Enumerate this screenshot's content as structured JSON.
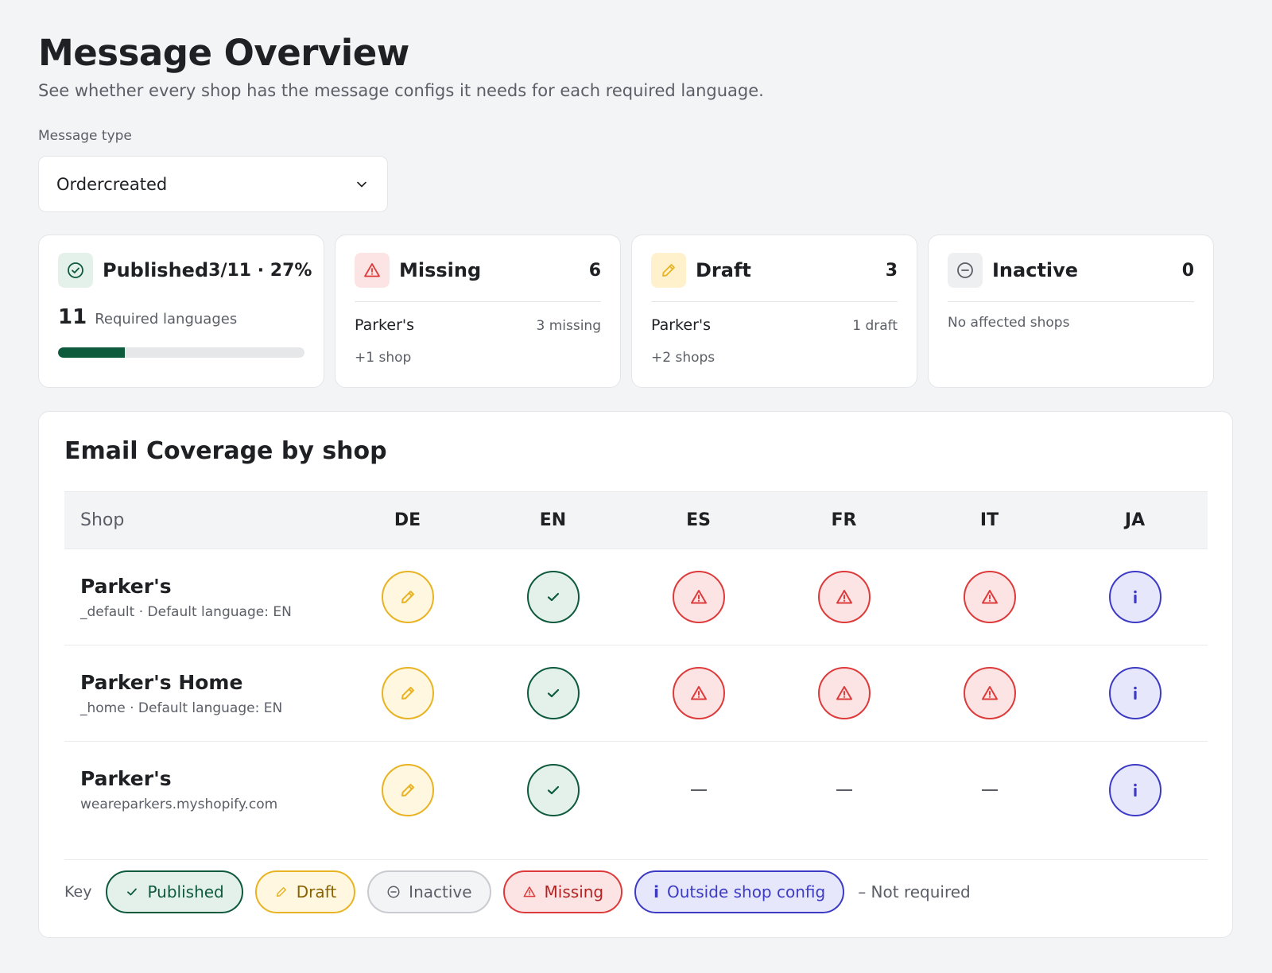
{
  "page": {
    "title": "Message Overview",
    "subtitle": "See whether every shop has the message configs it needs for each required language."
  },
  "filter": {
    "label": "Message type",
    "value": "Ordercreated"
  },
  "summary": {
    "published": {
      "title": "Published",
      "count": "3/11 · 27%",
      "required_count": "11",
      "required_label": "Required languages",
      "progress_percent": 27
    },
    "missing": {
      "title": "Missing",
      "count": "6",
      "shop": "Parker's",
      "note": "3 missing",
      "more": "+1 shop"
    },
    "draft": {
      "title": "Draft",
      "count": "3",
      "shop": "Parker's",
      "note": "1 draft",
      "more": "+2 shops"
    },
    "inactive": {
      "title": "Inactive",
      "count": "0",
      "empty": "No affected shops"
    }
  },
  "coverage": {
    "title": "Email Coverage by shop",
    "shop_header": "Shop",
    "languages": [
      "DE",
      "EN",
      "ES",
      "FR",
      "IT",
      "JA"
    ],
    "rows": [
      {
        "name": "Parker's",
        "meta": "_default · Default language: EN",
        "statuses": [
          "draft",
          "published",
          "missing",
          "missing",
          "missing",
          "outside"
        ]
      },
      {
        "name": "Parker's Home",
        "meta": "_home · Default language: EN",
        "statuses": [
          "draft",
          "published",
          "missing",
          "missing",
          "missing",
          "outside"
        ]
      },
      {
        "name": "Parker's",
        "meta": "weareparkers.myshopify.com",
        "statuses": [
          "draft",
          "published",
          "none",
          "none",
          "none",
          "outside"
        ]
      }
    ]
  },
  "key": {
    "label": "Key",
    "published": "Published",
    "draft": "Draft",
    "inactive": "Inactive",
    "missing": "Missing",
    "outside_icon": "i",
    "outside": "Outside shop config",
    "not_required": "– Not required"
  },
  "colors": {
    "published": "#0e5a3c",
    "draft": "#e8b324",
    "missing": "#dd3b3b",
    "outside": "#3d3bc4",
    "inactive": "#5b5e66"
  },
  "status_icons": {
    "published": "check-icon",
    "draft": "pencil-icon",
    "missing": "warning-icon",
    "outside": "info-icon",
    "none": "dash-icon"
  }
}
